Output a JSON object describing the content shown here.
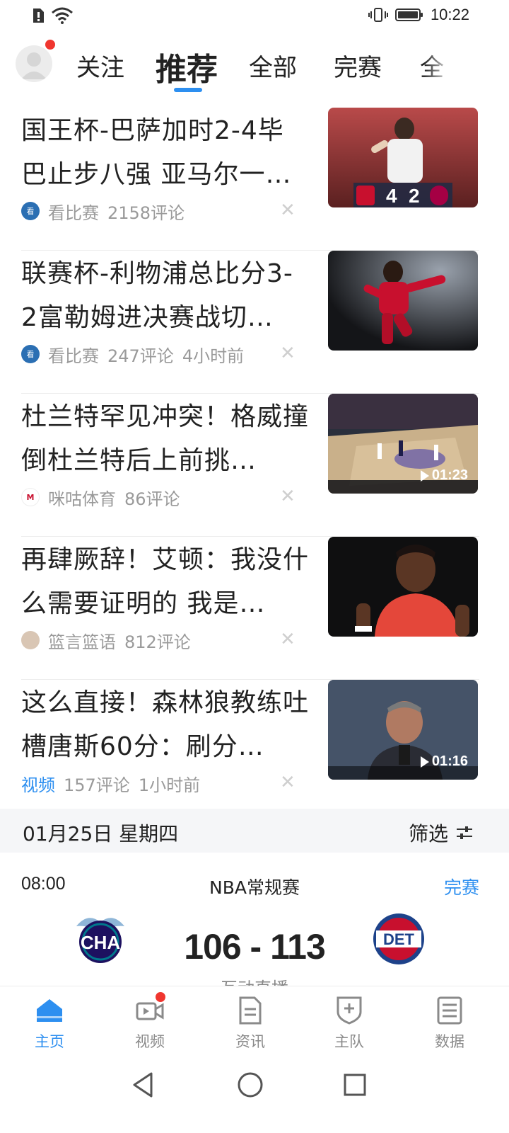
{
  "status_bar": {
    "time": "10:22"
  },
  "top_tabs": {
    "items": [
      "关注",
      "推荐",
      "全部",
      "完赛",
      "全"
    ],
    "active_index": 1
  },
  "news": [
    {
      "title": "国王杯-巴萨加时2-4毕巴止步八强 亚马尔一…",
      "source": "看比赛",
      "comments": "2158评论",
      "time": "",
      "score_left": "4",
      "score_right": "2"
    },
    {
      "title": "联赛杯-利物浦总比分3-2富勒姆进决赛战切…",
      "source": "看比赛",
      "comments": "247评论",
      "time": "4小时前"
    },
    {
      "title": "杜兰特罕见冲突！格威撞倒杜兰特后上前挑…",
      "source": "咪咕体育",
      "comments": "86评论",
      "time": "",
      "duration": "01:23"
    },
    {
      "title": "再肆厥辞！艾顿：我没什么需要证明的 我是…",
      "source": "篮言篮语",
      "comments": "812评论",
      "time": ""
    },
    {
      "title": "这么直接！森林狼教练吐槽唐斯60分：刷分…",
      "source": "视频",
      "comments": "157评论",
      "time": "1小时前",
      "duration": "01:16"
    }
  ],
  "date_bar": {
    "date": "01月25日 星期四",
    "filter": "筛选"
  },
  "game": {
    "time": "08:00",
    "league": "NBA常规赛",
    "status": "完赛",
    "home_abbr": "CHA",
    "away_abbr": "DET",
    "score": "106 - 113",
    "hint": "互动直播"
  },
  "bottom_nav": {
    "items": [
      "主页",
      "视频",
      "资讯",
      "主队",
      "数据"
    ],
    "active_index": 0
  },
  "colors": {
    "accent": "#2d8ff0",
    "badge": "#f0362f",
    "meta": "#9a9a9a"
  }
}
